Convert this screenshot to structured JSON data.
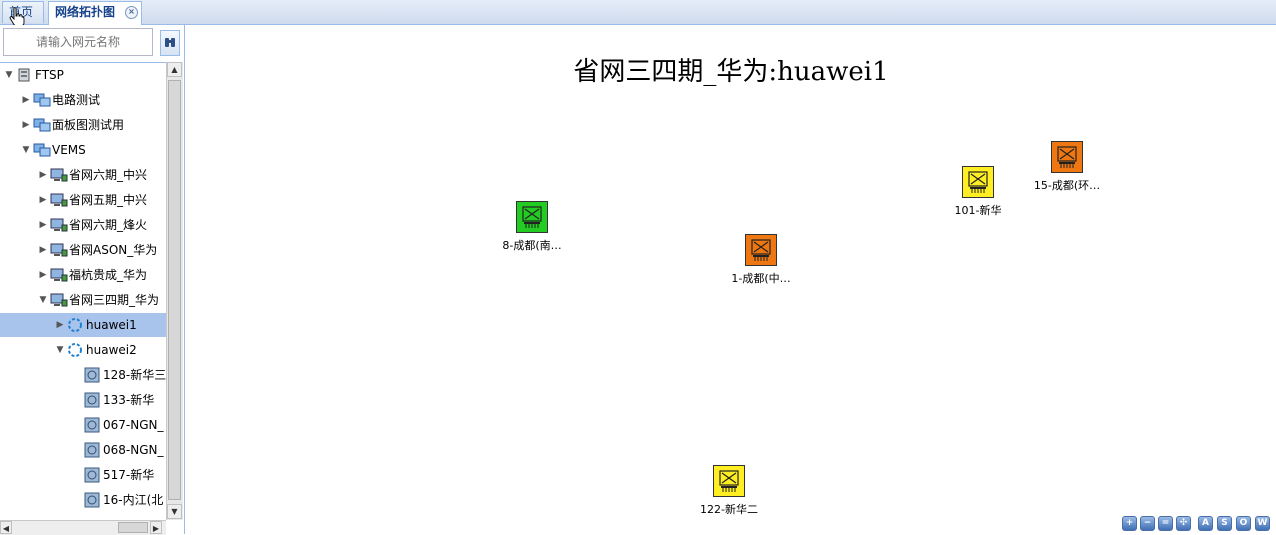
{
  "tabs": {
    "home_label": "首页",
    "topology_label": "网络拓扑图",
    "close_glyph": "×"
  },
  "sidebar": {
    "search_placeholder": "请输入网元名称",
    "tree": [
      {
        "label": "FTSP",
        "expanded": true,
        "icon": "root-server-icon"
      },
      {
        "label": "电路测试",
        "expanded": false,
        "icon": "folder-network-icon"
      },
      {
        "label": "面板图测试用",
        "expanded": false,
        "icon": "folder-network-icon"
      },
      {
        "label": "VEMS",
        "expanded": true,
        "icon": "folder-network-icon"
      },
      {
        "label": "省网六期_中兴",
        "expanded": false,
        "icon": "ems-server-icon"
      },
      {
        "label": "省网五期_中兴",
        "expanded": false,
        "icon": "ems-server-icon"
      },
      {
        "label": "省网六期_烽火",
        "expanded": false,
        "icon": "ems-server-icon"
      },
      {
        "label": "省网ASON_华为",
        "expanded": false,
        "icon": "ems-server-icon"
      },
      {
        "label": "福杭贵成_华为",
        "expanded": false,
        "icon": "ems-server-icon"
      },
      {
        "label": "省网三四期_华为",
        "expanded": true,
        "icon": "ems-server-icon"
      },
      {
        "label": "huawei1",
        "expanded": false,
        "icon": "subnet-ring-icon",
        "selected": true
      },
      {
        "label": "huawei2",
        "expanded": true,
        "icon": "subnet-ring-icon"
      },
      {
        "label": "128-新华三",
        "icon": "network-element-icon"
      },
      {
        "label": "133-新华",
        "icon": "network-element-icon"
      },
      {
        "label": "067-NGN_",
        "icon": "network-element-icon"
      },
      {
        "label": "068-NGN_",
        "icon": "network-element-icon"
      },
      {
        "label": "517-新华",
        "icon": "network-element-icon"
      },
      {
        "label": "16-内江(北",
        "icon": "network-element-icon"
      }
    ]
  },
  "topology": {
    "title": "省网三四期_华为:huawei1",
    "devices": [
      {
        "label": "8-成都(南…",
        "color": "#22cc22",
        "status": "green"
      },
      {
        "label": "1-成都(中…",
        "color": "#ee7711",
        "status": "orange"
      },
      {
        "label": "101-新华",
        "color": "#ffee22",
        "status": "yellow"
      },
      {
        "label": "15-成都(环…",
        "color": "#ee7711",
        "status": "orange"
      },
      {
        "label": "122-新华二",
        "color": "#ffee22",
        "status": "yellow"
      }
    ],
    "toolbar": [
      {
        "name": "zoom-in-icon",
        "glyph": "+"
      },
      {
        "name": "zoom-out-icon",
        "glyph": "−"
      },
      {
        "name": "zoom-reset-icon",
        "glyph": "="
      },
      {
        "name": "fit-view-icon",
        "glyph": "✣"
      },
      {
        "name": "layout-a-button",
        "glyph": "A"
      },
      {
        "name": "layout-s-button",
        "glyph": "S"
      },
      {
        "name": "layout-o-button",
        "glyph": "O"
      },
      {
        "name": "layout-w-button",
        "glyph": "W"
      }
    ]
  }
}
